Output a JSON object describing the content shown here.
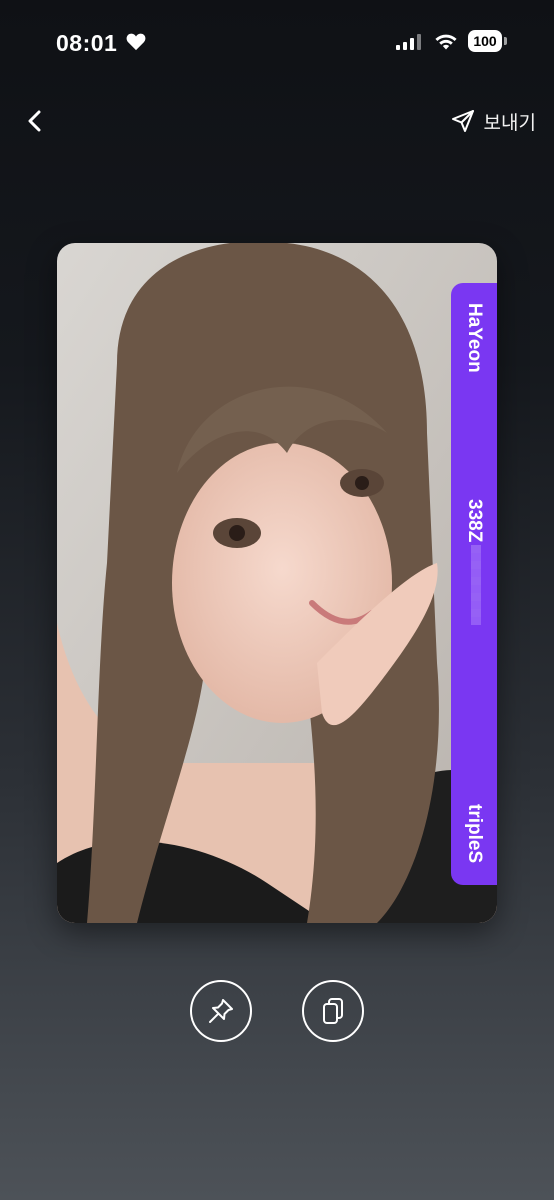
{
  "status_bar": {
    "time": "08:01",
    "battery": "100",
    "icons": [
      "heart-icon",
      "cellular-signal-icon",
      "wifi-icon",
      "battery-icon"
    ]
  },
  "nav": {
    "back_icon": "chevron-left-icon",
    "send_icon": "paper-plane-icon",
    "send_label": "보내기"
  },
  "card": {
    "member": "HaYeon",
    "serial": "338Z",
    "group": "tripleS",
    "band_color": "#7a37f2"
  },
  "actions": {
    "pin_icon": "pin-icon",
    "copy_icon": "copy-icon"
  }
}
